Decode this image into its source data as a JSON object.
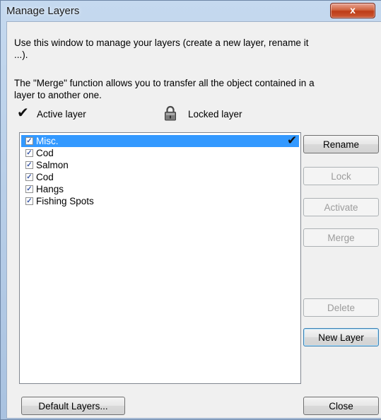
{
  "window": {
    "title": "Manage Layers",
    "close_glyph": "x"
  },
  "intro": {
    "line1": "Use this window to manage your layers (create a new layer, rename it",
    "line2": "...).",
    "merge_line1": "The \"Merge\" function allows you to transfer all the object contained in a",
    "merge_line2": "layer to another one."
  },
  "legend": {
    "active_icon": "checkmark-icon",
    "active_glyph": "✔",
    "active_label": "Active layer",
    "locked_icon": "padlock-icon",
    "locked_label": "Locked layer"
  },
  "layers": [
    {
      "name": "Misc.",
      "checked": true,
      "selected": true,
      "active": true
    },
    {
      "name": "Cod",
      "checked": true,
      "selected": false,
      "active": false
    },
    {
      "name": "Salmon",
      "checked": true,
      "selected": false,
      "active": false
    },
    {
      "name": "Cod",
      "checked": true,
      "selected": false,
      "active": false
    },
    {
      "name": "Hangs",
      "checked": true,
      "selected": false,
      "active": false
    },
    {
      "name": "Fishing Spots",
      "checked": true,
      "selected": false,
      "active": false
    }
  ],
  "buttons": {
    "rename": "Rename",
    "lock": "Lock",
    "activate": "Activate",
    "merge": "Merge",
    "delete": "Delete",
    "new_layer": "New Layer",
    "default_layers": "Default Layers...",
    "close": "Close"
  },
  "colors": {
    "selection": "#3399ff",
    "title_bar": "#b4cbe6",
    "close_button": "#c94a26",
    "disabled_text": "#9c9c9c"
  }
}
